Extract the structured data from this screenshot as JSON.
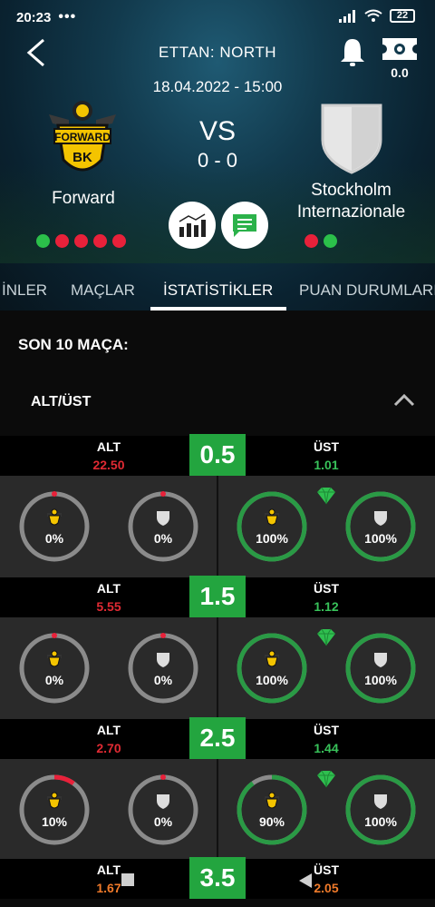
{
  "status": {
    "time": "20:23",
    "dots": "•••",
    "battery": "22"
  },
  "header": {
    "league": "ETTAN: NORTH",
    "date": "18.04.2022 - 15:00",
    "ticket_value": "0.0",
    "vs": "VS",
    "score": "0 - 0",
    "home": {
      "name": "Forward",
      "logo_text_top": "FORWARD",
      "logo_text_bottom": "BK",
      "form": [
        "g",
        "r",
        "r",
        "r",
        "r"
      ]
    },
    "away": {
      "name_line1": "Stockholm",
      "name_line2": "Internazionale",
      "form": [
        "r",
        "g"
      ]
    }
  },
  "tabs": [
    "İNLER",
    "MAÇLAR",
    "İSTATİSTİKLER",
    "PUAN DURUMLARI"
  ],
  "active_tab": "İSTATİSTİKLER",
  "section": {
    "title": "SON 10 MAÇA:",
    "subtitle": "ALT/ÜST"
  },
  "colors": {
    "green": "#23a53f",
    "red": "#e8213a",
    "ring_grey": "#8b8b8b",
    "ring_green": "#2a9a45",
    "odds_red": "#e02a33",
    "odds_green": "#38c25a",
    "odds_orange": "#f07a2a"
  },
  "lines": [
    {
      "line": "0.5",
      "alt_label": "ALT",
      "alt_odds": "22.50",
      "ust_label": "ÜST",
      "ust_odds": "1.01",
      "alt_home": "0%",
      "alt_away": "0%",
      "ust_home": "100%",
      "ust_away": "100%",
      "alt_home_frac": 0.0,
      "alt_away_frac": 0.0,
      "ust_home_frac": 1.0,
      "ust_away_frac": 1.0
    },
    {
      "line": "1.5",
      "alt_label": "ALT",
      "alt_odds": "5.55",
      "ust_label": "ÜST",
      "ust_odds": "1.12",
      "alt_home": "0%",
      "alt_away": "0%",
      "ust_home": "100%",
      "ust_away": "100%",
      "alt_home_frac": 0.0,
      "alt_away_frac": 0.0,
      "ust_home_frac": 1.0,
      "ust_away_frac": 1.0
    },
    {
      "line": "2.5",
      "alt_label": "ALT",
      "alt_odds": "2.70",
      "ust_label": "ÜST",
      "ust_odds": "1.44",
      "alt_home": "10%",
      "alt_away": "0%",
      "ust_home": "90%",
      "ust_away": "100%",
      "alt_home_frac": 0.1,
      "alt_away_frac": 0.0,
      "ust_home_frac": 0.9,
      "ust_away_frac": 1.0
    },
    {
      "line": "3.5",
      "alt_label": "ALT",
      "alt_odds": "1.67",
      "ust_label": "ÜST",
      "ust_odds": "2.05"
    }
  ]
}
